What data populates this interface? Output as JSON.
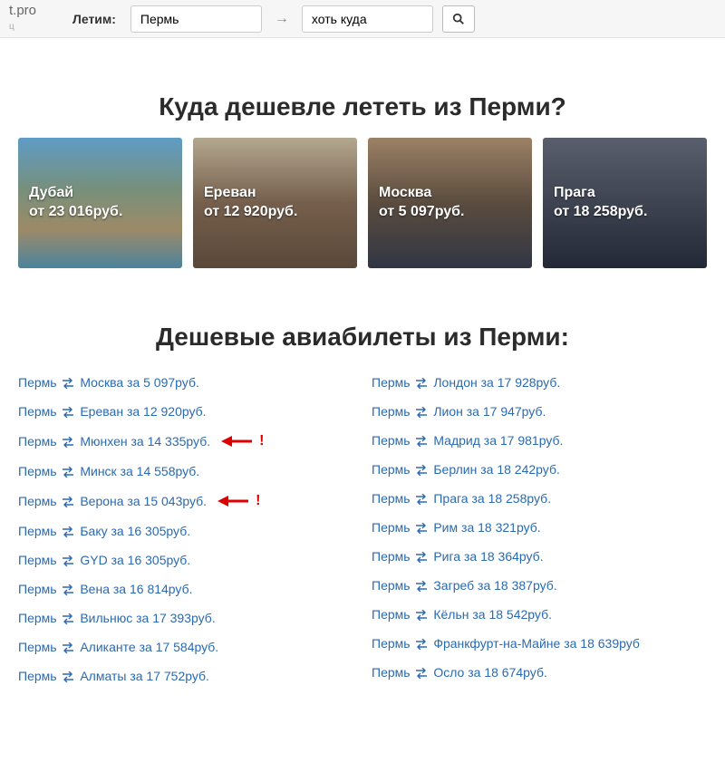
{
  "header": {
    "logo_suffix": "t.pro",
    "logo_sub": "ц",
    "form_label": "Летим:",
    "from_value": "Пермь",
    "arrow": "→",
    "to_value": "хоть куда"
  },
  "section1_title": "Куда дешевле лететь из Перми?",
  "cards": [
    {
      "city": "Дубай",
      "price": "от 23 016руб."
    },
    {
      "city": "Ереван",
      "price": "от 12 920руб."
    },
    {
      "city": "Москва",
      "price": "от 5 097руб."
    },
    {
      "city": "Прага",
      "price": "от 18 258руб."
    }
  ],
  "section2_title": "Дешевые авиабилеты из Перми:",
  "routes_left": [
    {
      "from": "Пермь",
      "to": "Москва",
      "price": "за 5 097руб.",
      "highlight": false
    },
    {
      "from": "Пермь",
      "to": "Ереван",
      "price": "за 12 920руб.",
      "highlight": false
    },
    {
      "from": "Пермь",
      "to": "Мюнхен",
      "price": "за 14 335руб.",
      "highlight": true
    },
    {
      "from": "Пермь",
      "to": "Минск",
      "price": "за 14 558руб.",
      "highlight": false
    },
    {
      "from": "Пермь",
      "to": "Верона",
      "price": "за 15 043руб.",
      "highlight": true
    },
    {
      "from": "Пермь",
      "to": "Баку",
      "price": "за 16 305руб.",
      "highlight": false
    },
    {
      "from": "Пермь",
      "to": "GYD",
      "price": "за 16 305руб.",
      "highlight": false
    },
    {
      "from": "Пермь",
      "to": "Вена",
      "price": "за 16 814руб.",
      "highlight": false
    },
    {
      "from": "Пермь",
      "to": "Вильнюс",
      "price": "за 17 393руб.",
      "highlight": false
    },
    {
      "from": "Пермь",
      "to": "Аликанте",
      "price": "за 17 584руб.",
      "highlight": false
    },
    {
      "from": "Пермь",
      "to": "Алматы",
      "price": "за 17 752руб.",
      "highlight": false
    }
  ],
  "routes_right": [
    {
      "from": "Пермь",
      "to": "Лондон",
      "price": "за 17 928руб.",
      "highlight": false
    },
    {
      "from": "Пермь",
      "to": "Лион",
      "price": "за 17 947руб.",
      "highlight": false
    },
    {
      "from": "Пермь",
      "to": "Мадрид",
      "price": "за 17 981руб.",
      "highlight": false
    },
    {
      "from": "Пермь",
      "to": "Берлин",
      "price": "за 18 242руб.",
      "highlight": false
    },
    {
      "from": "Пермь",
      "to": "Прага",
      "price": "за 18 258руб.",
      "highlight": false
    },
    {
      "from": "Пермь",
      "to": "Рим",
      "price": "за 18 321руб.",
      "highlight": false
    },
    {
      "from": "Пермь",
      "to": "Рига",
      "price": "за 18 364руб.",
      "highlight": false
    },
    {
      "from": "Пермь",
      "to": "Загреб",
      "price": "за 18 387руб.",
      "highlight": false
    },
    {
      "from": "Пермь",
      "to": "Кёльн",
      "price": "за 18 542руб.",
      "highlight": false
    },
    {
      "from": "Пермь",
      "to": "Франкфурт-на-Майне",
      "price": "за 18 639руб",
      "highlight": false
    },
    {
      "from": "Пермь",
      "to": "Осло",
      "price": "за 18 674руб.",
      "highlight": false
    }
  ]
}
